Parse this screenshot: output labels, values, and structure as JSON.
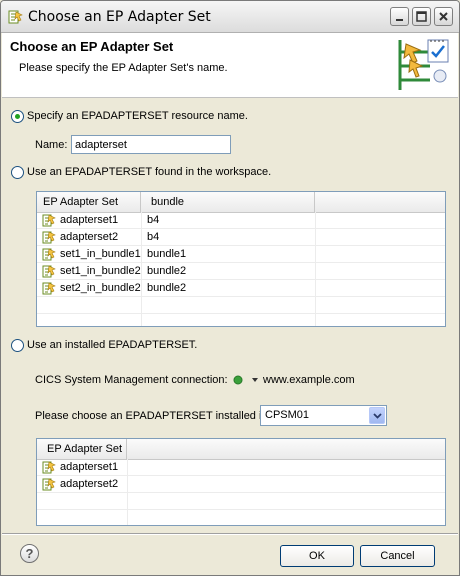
{
  "window": {
    "title": "Choose an EP Adapter Set"
  },
  "banner": {
    "title": "Choose an EP Adapter Set",
    "description": "Please specify the EP Adapter Set's name."
  },
  "option_specify": {
    "label": "Specify an EPADAPTERSET resource name.",
    "selected": true,
    "name_label": "Name:",
    "name_value": "adapterset"
  },
  "option_workspace": {
    "label": "Use an EPADAPTERSET found in the workspace.",
    "selected": false,
    "columns": [
      "EP Adapter Set",
      "bundle"
    ],
    "rows": [
      {
        "name": "adapterset1",
        "bundle": "b4"
      },
      {
        "name": "adapterset2",
        "bundle": "b4"
      },
      {
        "name": "set1_in_bundle1",
        "bundle": "bundle1"
      },
      {
        "name": "set1_in_bundle2",
        "bundle": "bundle2"
      },
      {
        "name": "set2_in_bundle2",
        "bundle": "bundle2"
      }
    ]
  },
  "option_installed": {
    "label": "Use an installed EPADAPTERSET.",
    "selected": false,
    "connection_label": "CICS System Management connection:",
    "connection_value": "www.example.com",
    "connection_status_color": "#3aa03a",
    "choose_label": "Please choose an EPADAPTERSET installed in:",
    "choose_value": "CPSM01",
    "columns": [
      "EP Adapter Set"
    ],
    "rows": [
      {
        "name": "adapterset1"
      },
      {
        "name": "adapterset2"
      }
    ]
  },
  "footer": {
    "help_label": "?",
    "ok_label": "OK",
    "cancel_label": "Cancel"
  }
}
